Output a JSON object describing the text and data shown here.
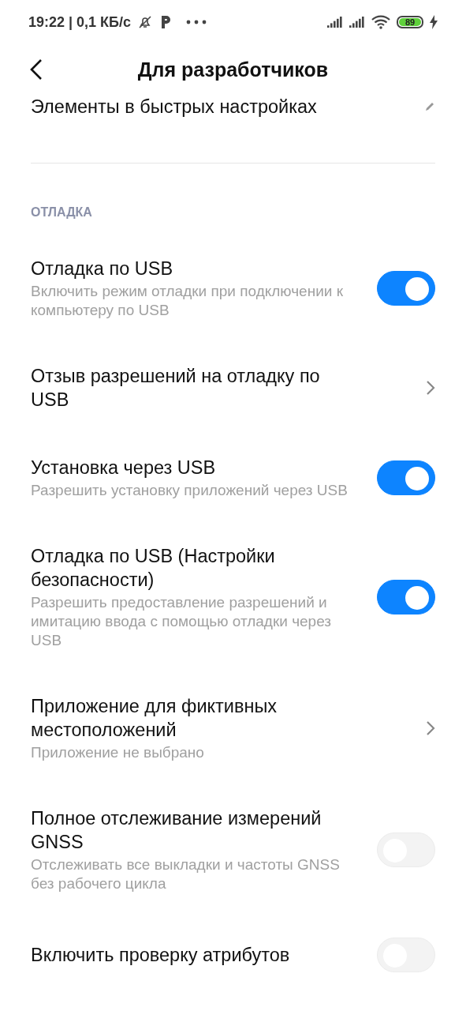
{
  "status_bar": {
    "time_and_speed": "19:22 | 0,1 КБ/с",
    "battery": "89",
    "charging": true
  },
  "header": {
    "title": "Для разработчиков"
  },
  "top_item": {
    "title": "Элементы в быстрых настройках",
    "kind": "edit"
  },
  "sections": [
    {
      "title": "ОТЛАДКА",
      "items": [
        {
          "kind": "toggle",
          "title": "Отладка по USB",
          "subtitle": "Включить режим отладки при подключении к компьютеру по USB",
          "on": true
        },
        {
          "kind": "link",
          "title": "Отзыв разрешений на отладку по USB"
        },
        {
          "kind": "toggle",
          "title": "Установка через USB",
          "subtitle": "Разрешить установку приложений через USB",
          "on": true
        },
        {
          "kind": "toggle",
          "title": "Отладка по USB (Настройки безопасности)",
          "subtitle": "Разрешить предоставление разрешений и имитацию ввода с помощью отладки через USB",
          "on": true
        },
        {
          "kind": "link",
          "title": "Приложение для фиктивных местоположений",
          "subtitle": "Приложение не выбрано"
        },
        {
          "kind": "toggle",
          "title": "Полное отслеживание измерений GNSS",
          "subtitle": "Отслеживать все выкладки и частоты GNSS без рабочего цикла",
          "on": false
        },
        {
          "kind": "toggle",
          "title": "Включить проверку атрибутов",
          "on": false
        }
      ]
    }
  ]
}
